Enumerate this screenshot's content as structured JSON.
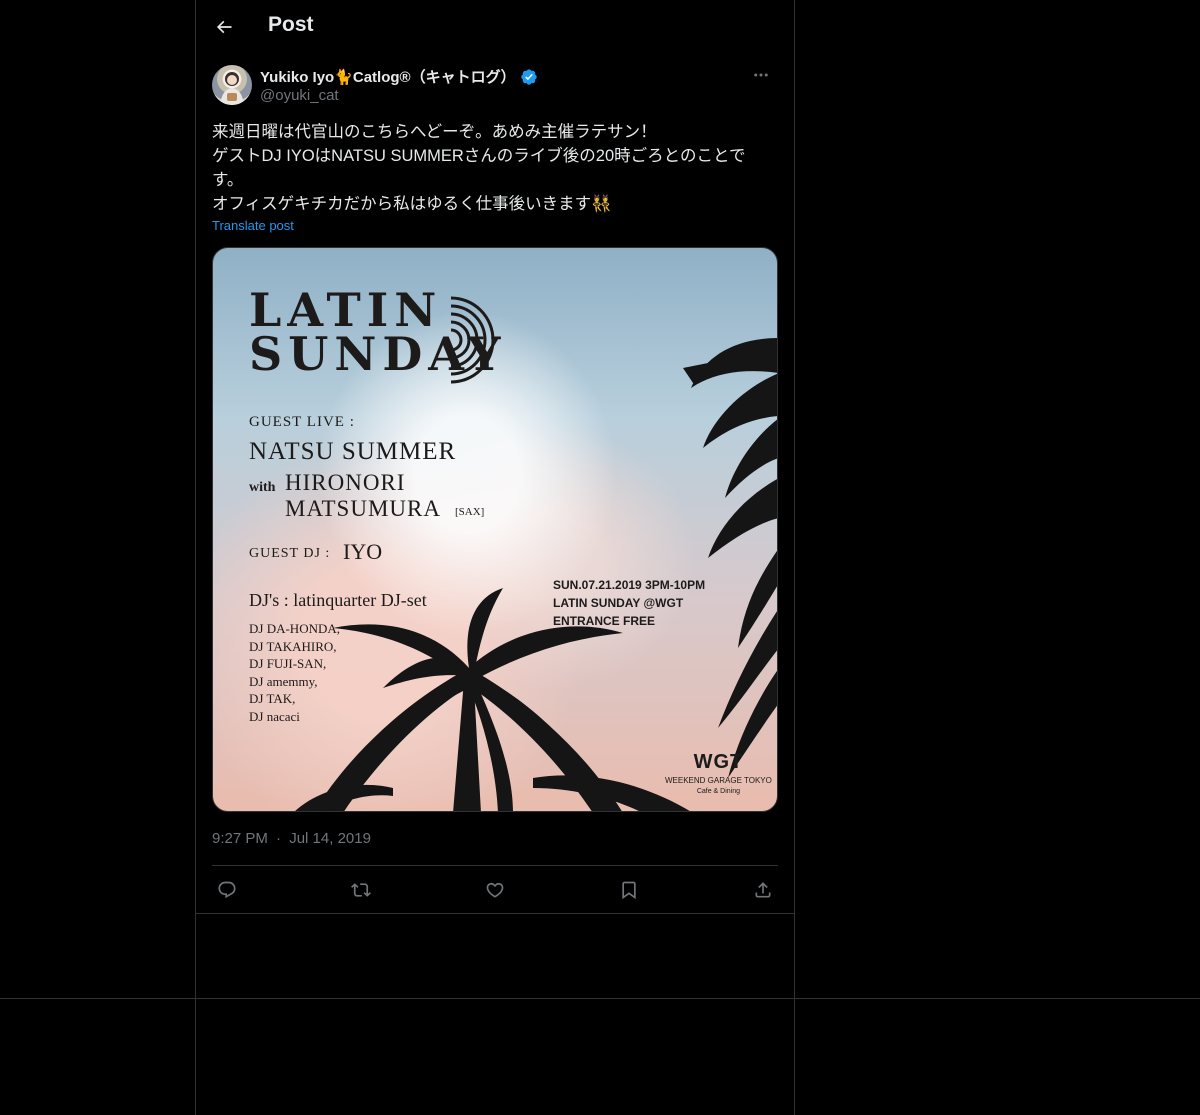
{
  "header": {
    "title": "Post",
    "back_icon": "arrow-left-icon"
  },
  "author": {
    "display_name": "Yukiko Iyo🐈Catlog®（キャトログ）",
    "handle": "@oyuki_cat",
    "verified": true
  },
  "post": {
    "lines": [
      "来週日曜は代官山のこちらへどーぞ。あめみ主催ラテサン！",
      "ゲストDJ IYOはNATSU SUMMERさんのライブ後の20時ごろとのことです。",
      "オフィスゲキチカだから私はゆるく仕事後いきます👯"
    ],
    "translate_label": "Translate post",
    "time": "9:27 PM",
    "separator": "·",
    "date": "Jul 14, 2019"
  },
  "poster": {
    "title_line1": "LATIN",
    "title_line2": "SUNDAY",
    "guest_live_label": "GUEST LIVE :",
    "guest_live_artist": "NATSU SUMMER",
    "with_label": "with",
    "collab_line1": "HIRONORI",
    "collab_line2": "MATSUMURA",
    "collab_instrument": "[SAX]",
    "guest_dj_label": "GUEST DJ :",
    "guest_dj": "IYO",
    "djs_label": "DJ's : latinquarter DJ-set",
    "djs": [
      "DJ DA-HONDA,",
      "DJ TAKAHIRO,",
      "DJ FUJI-SAN,",
      "DJ amemmy,",
      "DJ TAK,",
      "DJ nacaci"
    ],
    "info_line1": "SUN.07.21.2019 3PM-10PM",
    "info_line2": "LATIN SUNDAY @WGT",
    "info_line3": "ENTRANCE FREE",
    "venue_logo": "WGT",
    "venue_name": "WEEKEND GARAGE TOKYO",
    "venue_sub": "Cafe & Dining"
  },
  "actions": [
    {
      "name": "reply-button",
      "icon": "reply-icon"
    },
    {
      "name": "repost-button",
      "icon": "repost-icon"
    },
    {
      "name": "like-button",
      "icon": "heart-icon"
    },
    {
      "name": "bookmark-button",
      "icon": "bookmark-icon"
    },
    {
      "name": "share-button",
      "icon": "share-icon"
    }
  ],
  "colors": {
    "background": "#000000",
    "text": "#e7e9ea",
    "muted": "#71767b",
    "accent": "#1d9bf0",
    "border": "#2f3336"
  }
}
